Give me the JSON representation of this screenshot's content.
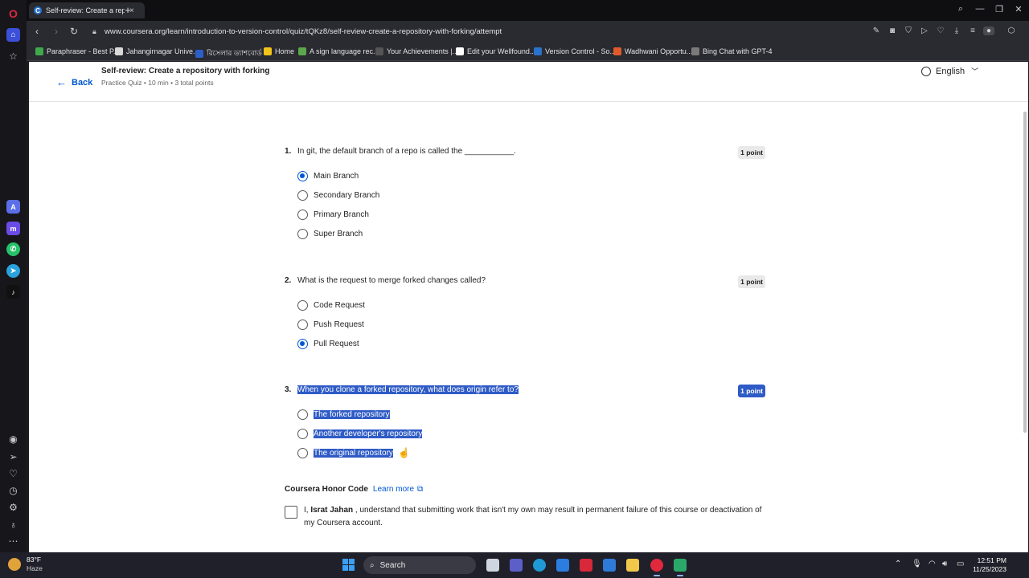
{
  "browser": {
    "tab_title": "Self-review: Create a repo",
    "tab_close": "×",
    "new_tab": "+",
    "url": "www.coursera.org/learn/introduction-to-version-control/quiz/tQKz8/self-review-create-a-repository-with-forking/attempt",
    "bookmarks": [
      {
        "label": "Paraphraser - Best P...",
        "color": "#3ea84b"
      },
      {
        "label": "Jahangirnagar Unive...",
        "color": "#d9d9d9"
      },
      {
        "label": "রিসেলার ড্যাশবোর্ড",
        "color": "#2d5fc8"
      },
      {
        "label": "Home",
        "color": "#f0c419"
      },
      {
        "label": "A sign language rec...",
        "color": "#5aa84b"
      },
      {
        "label": "Your Achievements |...",
        "color": "#555555"
      },
      {
        "label": "Edit your Wellfound...",
        "color": "#ffffff"
      },
      {
        "label": "Version Control - So...",
        "color": "#2a73cc"
      },
      {
        "label": "Wadhwani Opportu...",
        "color": "#e05a2b"
      },
      {
        "label": "Bing Chat with GPT-4",
        "color": "#7a7a7a"
      }
    ]
  },
  "page": {
    "back_label": "Back",
    "title": "Self-review: Create a repository with forking",
    "meta": "Practice Quiz • 10 min • 3 total points",
    "language": "English"
  },
  "questions": [
    {
      "num": "1.",
      "text": "In git, the default branch of a repo is called the ___________.",
      "points": "1 point",
      "options": [
        "Main Branch",
        "Secondary Branch",
        "Primary Branch",
        "Super Branch"
      ]
    },
    {
      "num": "2.",
      "text": "What is the request to merge forked changes called?",
      "points": "1 point",
      "options": [
        "Code Request",
        "Push Request",
        "Pull Request"
      ]
    },
    {
      "num": "3.",
      "text": "When you clone a forked repository, what does origin refer to?",
      "points": "1 point",
      "options": [
        "The forked repository",
        "Another developer's repository",
        "The original repository"
      ]
    }
  ],
  "honor": {
    "title": "Coursera Honor Code",
    "link": "Learn more",
    "text_prefix": "I, ",
    "name": "Israt Jahan",
    "text_suffix": " , understand that submitting work that isn't my own may result in permanent failure of this course or deactivation of my Coursera account."
  },
  "taskbar": {
    "temp": "83°F",
    "condition": "Haze",
    "search": "Search",
    "time": "12:51 PM",
    "date": "11/25/2023"
  },
  "colors": {
    "accent": "#0056d2",
    "selection": "#2e5bc6"
  }
}
